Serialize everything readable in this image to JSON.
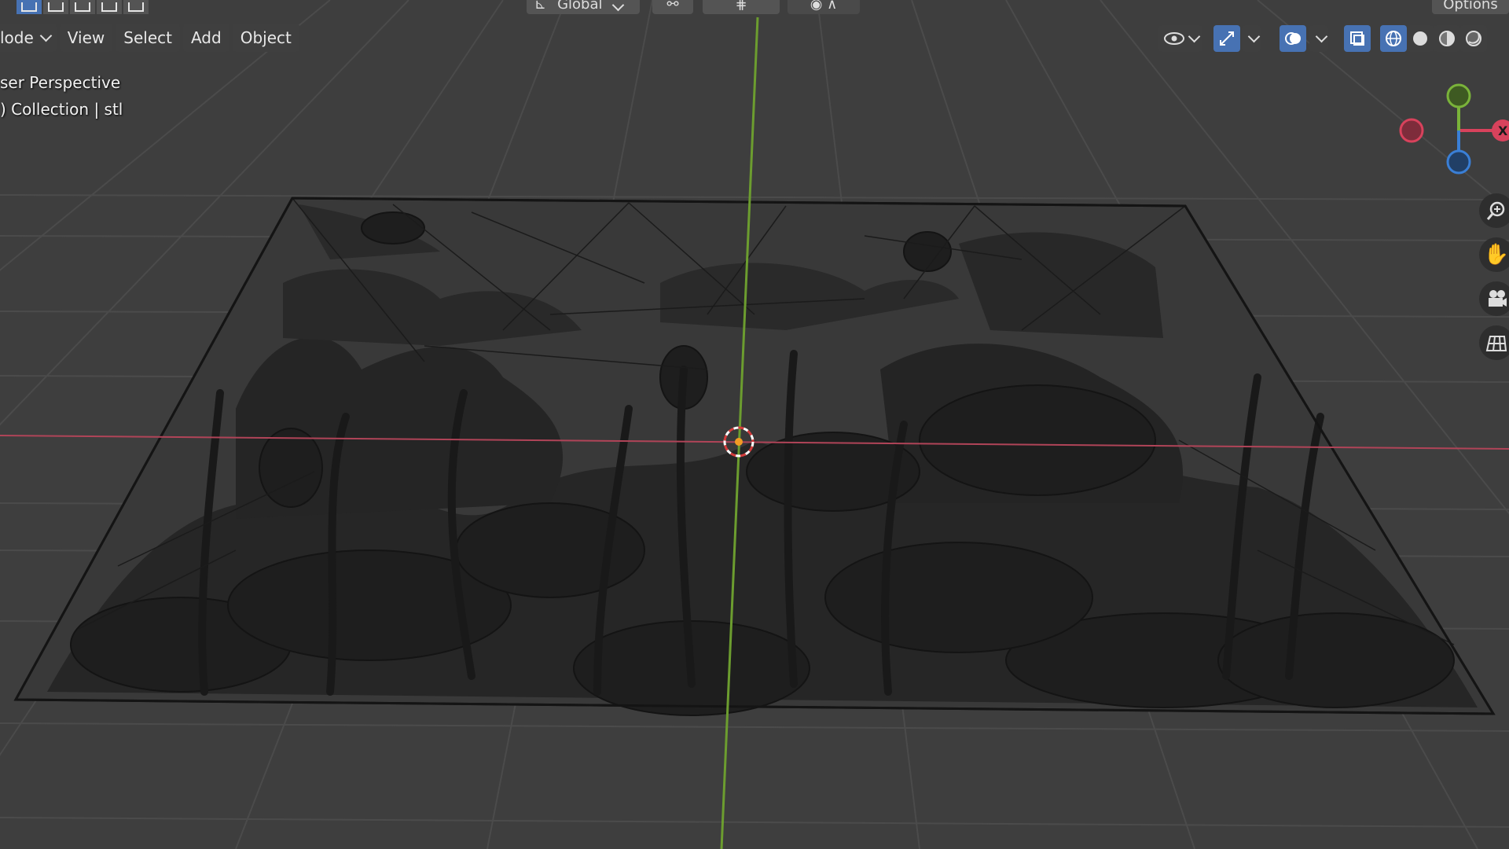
{
  "header": {
    "mode_label": "lode",
    "menus": [
      "View",
      "Select",
      "Add",
      "Object"
    ],
    "orientation_label": "Global",
    "options_label": "Options"
  },
  "overlay": {
    "view_name": "ser Perspective",
    "collection_info": ") Collection | stl"
  },
  "gizmo": {
    "x_label": "X"
  },
  "colors": {
    "accent": "#4772b3",
    "x_axis": "#d8425c",
    "y_axis": "#7ab33a",
    "z_axis": "#3a7fd6",
    "grid": "#4b4b4b",
    "mesh": "#1c1c1c"
  },
  "icons": {
    "select_modes": [
      "select-box-icon",
      "select-extend-icon",
      "select-subtract-icon",
      "select-invert-icon",
      "select-intersect-icon"
    ],
    "header_right": [
      "visibility-icon",
      "gizmo-icon",
      "overlay-icon",
      "xray-icon",
      "wireframe-shading-icon",
      "solid-shading-icon",
      "material-shading-icon",
      "rendered-shading-icon"
    ],
    "navigation": [
      "zoom-icon",
      "pan-hand-icon",
      "camera-icon",
      "ortho-grid-icon"
    ]
  }
}
